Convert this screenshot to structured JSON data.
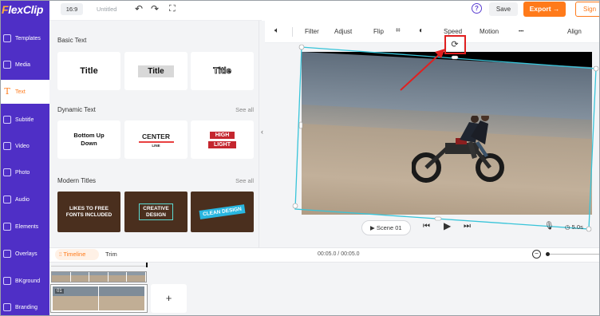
{
  "app": {
    "logo_prefix": "F",
    "logo_rest": "lexClip"
  },
  "topbar": {
    "ratio": "16:9",
    "title": "Untitled",
    "save": "Save",
    "export": "Export →",
    "signup": "Sign"
  },
  "sidebar": {
    "items": [
      {
        "label": "Templates",
        "icon": "templates-icon"
      },
      {
        "label": "Media",
        "icon": "media-icon"
      },
      {
        "label": "Text",
        "icon": "text-icon",
        "active": true
      },
      {
        "label": "Subtitle",
        "icon": "subtitle-icon"
      },
      {
        "label": "Video",
        "icon": "video-icon"
      },
      {
        "label": "Photo",
        "icon": "photo-icon"
      },
      {
        "label": "Audio",
        "icon": "audio-icon"
      },
      {
        "label": "Elements",
        "icon": "elements-icon"
      },
      {
        "label": "Overlays",
        "icon": "overlays-icon"
      },
      {
        "label": "BKground",
        "icon": "background-icon"
      },
      {
        "label": "Branding",
        "icon": "branding-icon"
      }
    ]
  },
  "panel": {
    "basic_title": "Basic Text",
    "basic": [
      "Title",
      "Title",
      "Title"
    ],
    "dynamic_title": "Dynamic Text",
    "dynamic_see_all": "See all",
    "dynamic": {
      "bottom_up_1": "Bottom Up",
      "bottom_up_2": "Down",
      "center": "CENTER",
      "center_sub": "LINE",
      "high": "HIGH",
      "light": "LIGHT"
    },
    "modern_title": "Modern Titles",
    "modern_see_all": "See all",
    "modern": {
      "m1_a": "LIKES TO FREE",
      "m1_b": "FONTS INCLUDED",
      "m2_a": "CREATIVE",
      "m2_b": "DESIGN",
      "m3": "CLEAN DESIGN"
    }
  },
  "edit_toolbar": {
    "filter": "Filter",
    "adjust": "Adjust",
    "flip": "Flip",
    "speed": "Speed",
    "motion": "Motion",
    "more": "•••",
    "align": "Align"
  },
  "player": {
    "scene": "Scene 01",
    "duration": "5.0s"
  },
  "timeline": {
    "tab": "Timeline",
    "trim": "Trim",
    "time": "00:05.0 / 00:05.0",
    "clip_index": "01",
    "add": "+"
  },
  "colors": {
    "brand": "#4f2fc6",
    "accent": "#ff7a1a",
    "highlight": "#e02020",
    "selection": "#38c4d9"
  }
}
